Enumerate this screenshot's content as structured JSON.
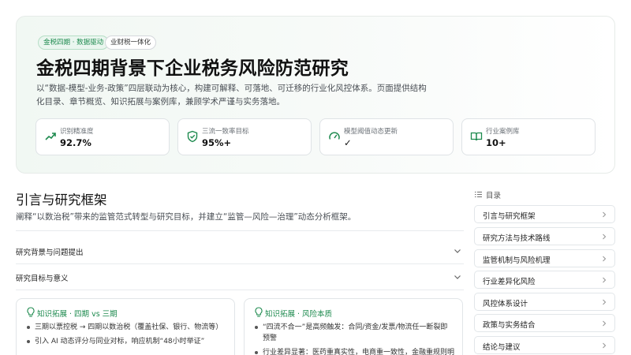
{
  "hero": {
    "tags": [
      "金税四期 · 数据驱动",
      "业财税一体化"
    ],
    "title": "金税四期背景下企业税务风险防范研究",
    "description": "以“数据-模型-业务-政策”四层联动为核心，构建可解释、可落地、可迁移的行业化风控体系。页面提供结构化目录、章节概览、知识拓展与案例库，兼顾学术严谨与实务落地。",
    "stats": [
      {
        "icon": "trend-up-icon",
        "label": "识别精准度",
        "value": "92.7%"
      },
      {
        "icon": "shield-check-icon",
        "label": "三流一致率目标",
        "value": "95%+"
      },
      {
        "icon": "gauge-icon",
        "label": "模型阈值动态更新",
        "value": "✓"
      },
      {
        "icon": "book-open-icon",
        "label": "行业案例库",
        "value": "10+"
      }
    ]
  },
  "section": {
    "title": "引言与研究框架",
    "description": "阐释“以数治税”带来的监管范式转型与研究目标，并建立“监管—风险—治理”动态分析框架。",
    "accordion": [
      "研究背景与问题提出",
      "研究目标与意义"
    ]
  },
  "cards": [
    {
      "title": "知识拓展 · 四期 vs 三期",
      "items": [
        "三期以票控税 → 四期以数治税（覆盖社保、银行、物流等）",
        "引入 AI 动态评分与同业对标，响应机制“48小时举证”"
      ]
    },
    {
      "title": "知识拓展 · 风险本质",
      "items": [
        "“四流不合一”是高频触发：合同/资金/发票/物流任一断裂即预警",
        "行业差异显著：医药重真实性，电商重一致性，金融重规则明确性"
      ]
    }
  ],
  "toc": {
    "heading": "目录",
    "items": [
      "引言与研究框架",
      "研究方法与技术路线",
      "监管机制与风险机理",
      "行业差异化风险",
      "风控体系设计",
      "政策与实务结合",
      "结论与建议"
    ]
  },
  "colors": {
    "accent": "#1d8a4e",
    "border": "#e1e5e8",
    "hero_bg": "#f1f8f3"
  }
}
